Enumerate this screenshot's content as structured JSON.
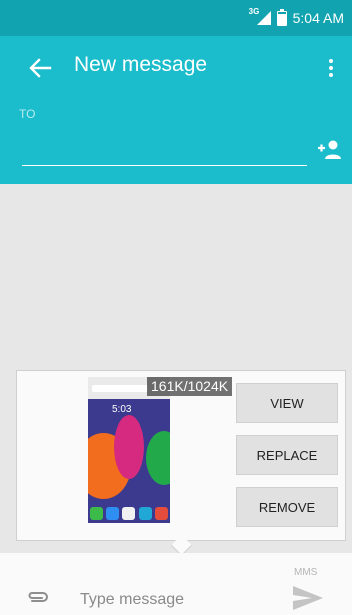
{
  "status_bar": {
    "network": "3G",
    "time": "5:04 AM",
    "icons": [
      "signal-icon",
      "battery-icon"
    ]
  },
  "app_bar": {
    "title": "New message",
    "to_label": "TO",
    "to_value": "",
    "icons": [
      "back-arrow-icon",
      "overflow-menu-icon",
      "add-contact-icon"
    ]
  },
  "attachment": {
    "size_label": "161K/1024K",
    "preview_icon": "screenshot-thumbnail-image",
    "buttons": {
      "view": "VIEW",
      "replace": "REPLACE",
      "remove": "REMOVE"
    }
  },
  "thumbnail": {
    "time": "5:03"
  },
  "compose": {
    "placeholder": "Type message",
    "value": "",
    "mms_label": "MMS",
    "icons": [
      "attach-icon",
      "send-icon"
    ]
  },
  "colors": {
    "status_bar": "#12a3b1",
    "app_bar": "#1bbccb",
    "content_bg": "#e7e7e7",
    "button_bg": "#e1e1e1"
  }
}
